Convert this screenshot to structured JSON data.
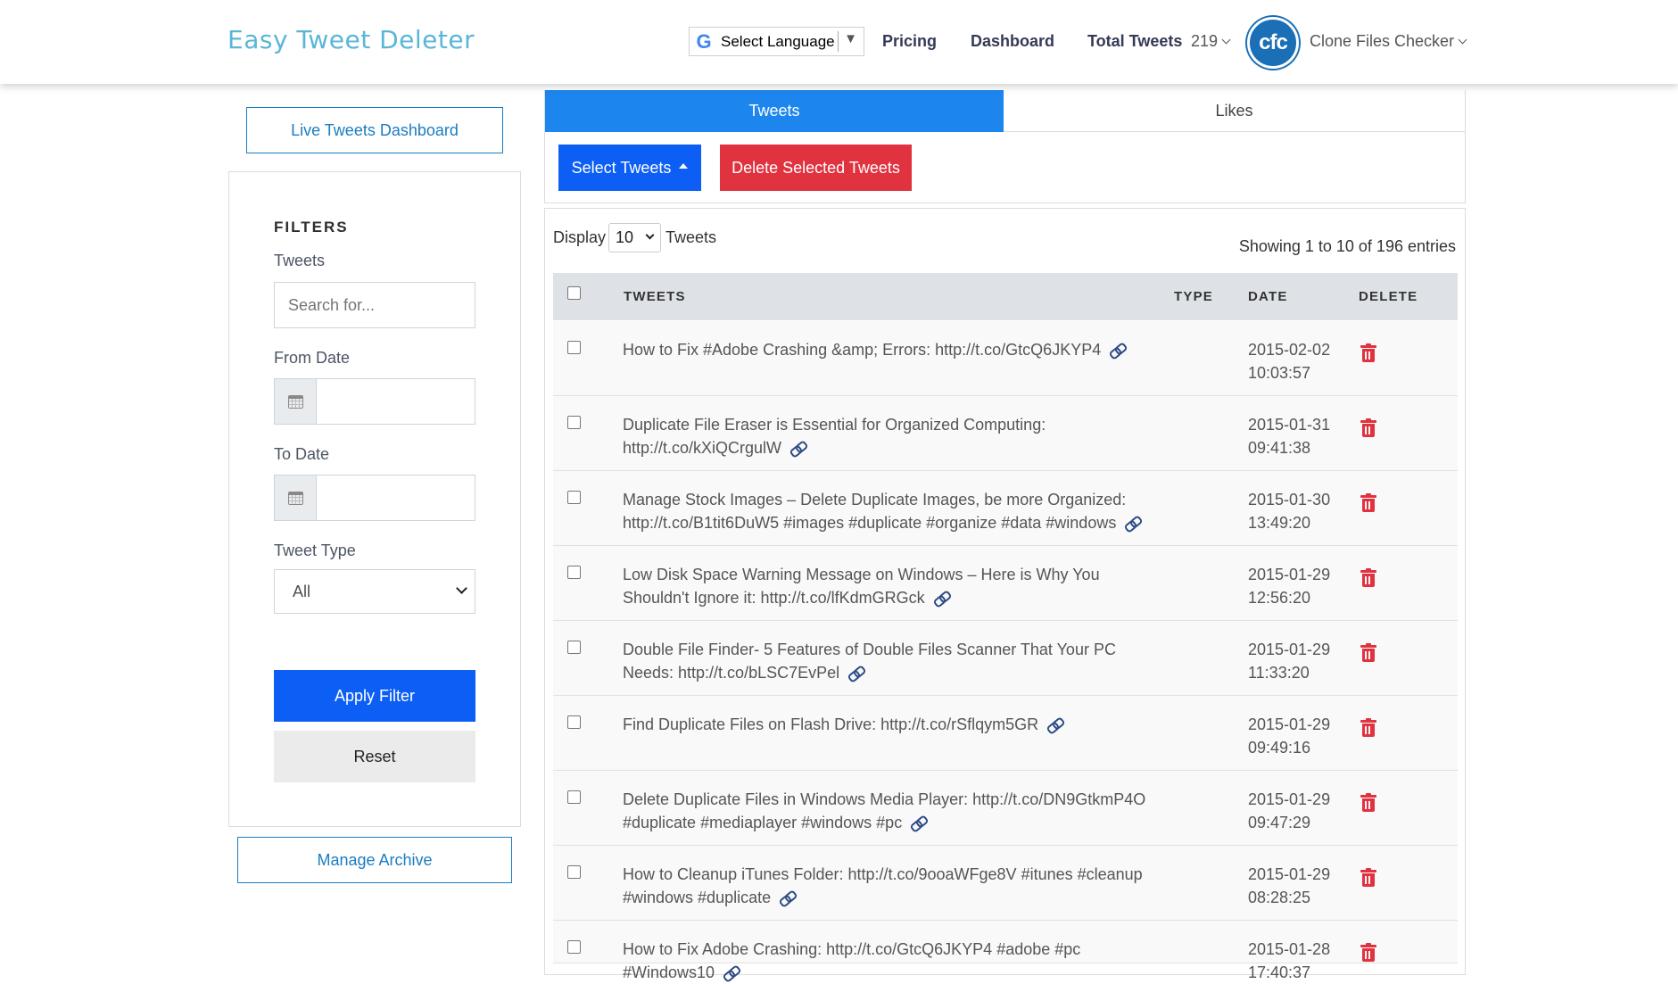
{
  "header": {
    "logo": "Easy Tweet Deleter",
    "language_label": "Select Language",
    "nav_pricing": "Pricing",
    "nav_dashboard": "Dashboard",
    "nav_total_label": "Total Tweets",
    "nav_total_count": "219",
    "avatar_text": "cfc",
    "user_name": "Clone Files Checker"
  },
  "sidebar": {
    "live_dashboard": "Live Tweets Dashboard",
    "filters_title": "FILTERS",
    "tweets_label": "Tweets",
    "search_placeholder": "Search for...",
    "from_date_label": "From Date",
    "to_date_label": "To Date",
    "tweet_type_label": "Tweet Type",
    "tweet_type_value": "All",
    "apply_filter": "Apply Filter",
    "reset": "Reset",
    "manage_archive": "Manage Archive"
  },
  "tabs": {
    "tweets": "Tweets",
    "likes": "Likes"
  },
  "actions": {
    "select_tweets": "Select Tweets",
    "delete_selected": "Delete Selected Tweets"
  },
  "table": {
    "display_label": "Display",
    "display_value": "10",
    "display_suffix": "Tweets",
    "showing": "Showing 1 to 10 of 196 entries",
    "headers": {
      "tweets": "TWEETS",
      "type": "TYPE",
      "date": "DATE",
      "delete": "DELETE"
    },
    "rows": [
      {
        "text": "How to Fix #Adobe Crashing &amp; Errors: http://t.co/GtcQ6JKYP4",
        "date": "2015-02-02",
        "time": "10:03:57"
      },
      {
        "text": "Duplicate File Eraser is Essential for Organized Computing: http://t.co/kXiQCrgulW",
        "date": "2015-01-31",
        "time": "09:41:38"
      },
      {
        "text": "Manage Stock Images – Delete Duplicate Images, be more Organized: http://t.co/B1tit6DuW5 #images #duplicate #organize #data #windows",
        "date": "2015-01-30",
        "time": "13:49:20"
      },
      {
        "text": "Low Disk Space Warning Message on Windows – Here is Why You Shouldn't Ignore it: http://t.co/lfKdmGRGck",
        "date": "2015-01-29",
        "time": "12:56:20"
      },
      {
        "text": "Double File Finder- 5 Features of Double Files Scanner That Your PC Needs: http://t.co/bLSC7EvPel",
        "date": "2015-01-29",
        "time": "11:33:20"
      },
      {
        "text": "Find Duplicate Files on Flash Drive: http://t.co/rSflqym5GR",
        "date": "2015-01-29",
        "time": "09:49:16"
      },
      {
        "text": "Delete Duplicate Files in Windows Media Player: http://t.co/DN9GtkmP4O #duplicate #mediaplayer #windows #pc",
        "date": "2015-01-29",
        "time": "09:47:29"
      },
      {
        "text": "How to Cleanup iTunes Folder: http://t.co/9ooaWFge8V #itunes #cleanup #windows #duplicate",
        "date": "2015-01-29",
        "time": "08:28:25"
      },
      {
        "text": "How to Fix Adobe Crashing: http://t.co/GtcQ6JKYP4 #adobe #pc #Windows10",
        "date": "2015-01-28",
        "time": "17:40:37"
      }
    ]
  }
}
